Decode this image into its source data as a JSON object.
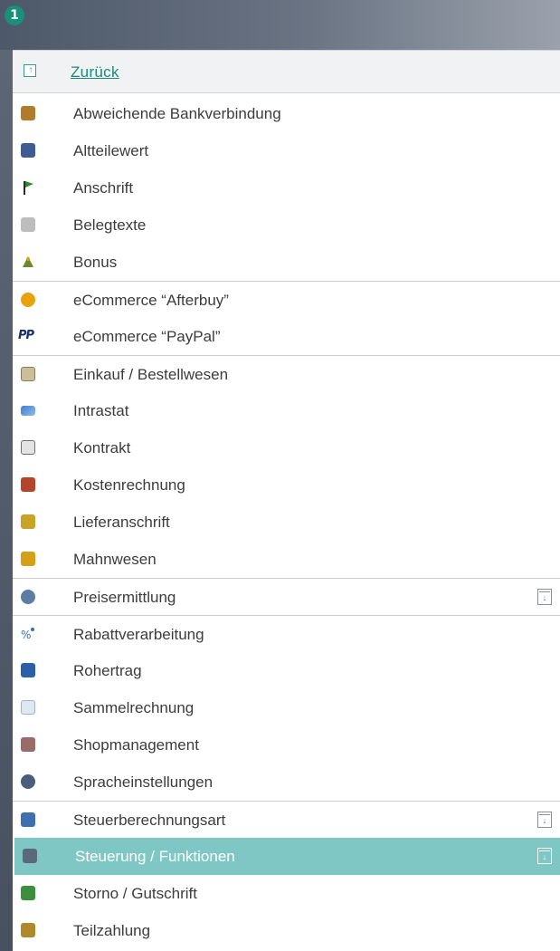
{
  "header": {
    "step_number": "1"
  },
  "back": {
    "label": "Zurück",
    "icon": "back-up-icon"
  },
  "menu": {
    "items": [
      {
        "label": "Abweichende Bankverbindung",
        "icon": "bank-icon",
        "color": "#b07b2a"
      },
      {
        "label": "Altteilewert",
        "icon": "parts-value-icon",
        "color": "#3e5c93"
      },
      {
        "label": "Anschrift",
        "icon": "flag-icon",
        "color": "#2e8b2e"
      },
      {
        "label": "Belegtexte",
        "icon": "document-text-icon",
        "color": "#9a9a9a"
      },
      {
        "label": "Bonus",
        "icon": "bonus-icon",
        "color": "#6a8a2a"
      },
      {
        "label": "eCommerce “Afterbuy”",
        "icon": "afterbuy-icon",
        "color": "#e8a20c"
      },
      {
        "label": "eCommerce “PayPal”",
        "icon": "paypal-icon",
        "color": "#1b2f6b"
      },
      {
        "label": "Einkauf / Bestellwesen",
        "icon": "clipboard-icon",
        "color": "#8a7a5a"
      },
      {
        "label": "Intrastat",
        "icon": "intrastat-icon",
        "color": "#3c7fd1"
      },
      {
        "label": "Kontrakt",
        "icon": "contract-icon",
        "color": "#6f6f6f"
      },
      {
        "label": "Kostenrechnung",
        "icon": "cost-accounting-icon",
        "color": "#b5442c"
      },
      {
        "label": "Lieferanschrift",
        "icon": "delivery-address-icon",
        "color": "#c9a227"
      },
      {
        "label": "Mahnwesen",
        "icon": "dunning-icon",
        "color": "#d4a017"
      },
      {
        "label": "Preisermittlung",
        "icon": "price-determination-icon",
        "color": "#5d7ca3"
      },
      {
        "label": "Rabattverarbeitung",
        "icon": "discount-icon",
        "color": "#3b6fa8"
      },
      {
        "label": "Rohertrag",
        "icon": "gross-profit-icon",
        "color": "#2d5ea8"
      },
      {
        "label": "Sammelrechnung",
        "icon": "collective-invoice-icon",
        "color": "#9bb3d0"
      },
      {
        "label": "Shopmanagement",
        "icon": "shop-icon",
        "color": "#9a6b6b"
      },
      {
        "label": "Spracheinstellungen",
        "icon": "language-icon",
        "color": "#4a5d7a"
      },
      {
        "label": "Steuerberechnungsart",
        "icon": "tax-calculation-icon",
        "color": "#3e6fb0"
      },
      {
        "label": "Steuerung / Funktionen",
        "icon": "control-functions-icon",
        "color": "#5a6a7a"
      },
      {
        "label": "Storno / Gutschrift",
        "icon": "credit-note-icon",
        "color": "#3c8f3c"
      },
      {
        "label": "Teilzahlung",
        "icon": "installment-icon",
        "color": "#b08a2a"
      }
    ]
  }
}
